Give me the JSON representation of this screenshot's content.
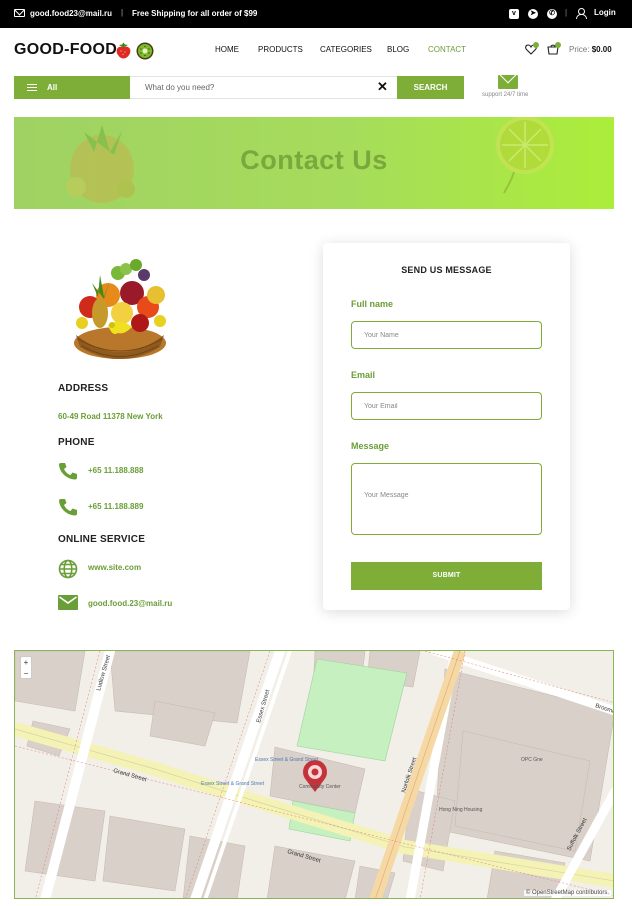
{
  "topbar": {
    "email": "good.food23@mail.ru",
    "separator": "|",
    "shipping": "Free Shipping for all order of $99",
    "login": "Login",
    "social_icons": [
      "vk-icon",
      "telegram-icon",
      "whatsapp-icon"
    ]
  },
  "header": {
    "logo": "GOOD-FOOD",
    "nav": [
      "HOME",
      "PRODUCTS",
      "CATEGORIES",
      "BLOG",
      "CONTACT"
    ],
    "active_nav": "CONTACT",
    "price_label": "Price:",
    "price_value": "$0.00"
  },
  "search": {
    "category": "All",
    "placeholder": "What do you need?",
    "clear": "✕",
    "button": "SEARCH",
    "support": "support 24/7 time"
  },
  "banner": {
    "title": "Contact Us"
  },
  "contact": {
    "address_heading": "ADDRESS",
    "address": "60-49 Road 11378 New York",
    "phone_heading": "PHONE",
    "phones": [
      "+65 11.188.888",
      "+65 11.188.889"
    ],
    "online_heading": "ONLINE SERVICE",
    "website": "www.site.com",
    "email": "good.food.23@mail.ru"
  },
  "form": {
    "title": "SEND US MESSAGE",
    "name_label": "Full name",
    "name_placeholder": "Your Name",
    "email_label": "Email",
    "email_placeholder": "Your Email",
    "message_label": "Message",
    "message_placeholder": "Your Message",
    "submit": "SUBMIT"
  },
  "map": {
    "zoom_in": "+",
    "zoom_out": "−",
    "attribution": "© OpenStreetMap contributors.",
    "labels": [
      "Grand Street",
      "Grand Street",
      "Essex Street",
      "Norfolk Street",
      "Suffolk Street",
      "Ludlow Street",
      "Broome",
      "Community Center",
      "Hong Ning Housing",
      "OPC Gne",
      "Essex Street & Grand Street",
      "Essex Street & Grand Street"
    ]
  },
  "colors": {
    "accent": "#7eae38",
    "accent_text": "#6a9e36",
    "topbar": "#000000",
    "banner_start": "#9fd263",
    "banner_end": "#aced3a"
  }
}
